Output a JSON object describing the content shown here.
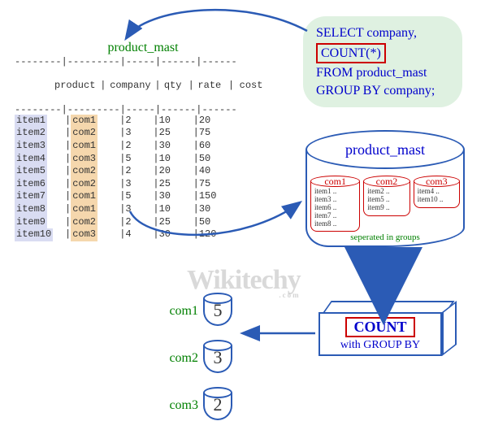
{
  "table": {
    "title": "product_mast",
    "headers": {
      "product": "product",
      "company": "company",
      "qty": "qty",
      "rate": "rate",
      "cost": "cost"
    },
    "dash_row": "--------|---------|-----|------|------",
    "rows": [
      {
        "product": "item1",
        "company": "com1",
        "qty": "2",
        "rate": "10",
        "cost": "20"
      },
      {
        "product": "item2",
        "company": "com2",
        "qty": "3",
        "rate": "25",
        "cost": "75"
      },
      {
        "product": "item3",
        "company": "com1",
        "qty": "2",
        "rate": "30",
        "cost": "60"
      },
      {
        "product": "item4",
        "company": "com3",
        "qty": "5",
        "rate": "10",
        "cost": "50"
      },
      {
        "product": "item5",
        "company": "com2",
        "qty": "2",
        "rate": "20",
        "cost": "40"
      },
      {
        "product": "item6",
        "company": "com2",
        "qty": "3",
        "rate": "25",
        "cost": "75"
      },
      {
        "product": "item7",
        "company": "com1",
        "qty": "5",
        "rate": "30",
        "cost": "150"
      },
      {
        "product": "item8",
        "company": "com1",
        "qty": "3",
        "rate": "10",
        "cost": "30"
      },
      {
        "product": "item9",
        "company": "com2",
        "qty": "2",
        "rate": "25",
        "cost": "50"
      },
      {
        "product": "item10",
        "company": "com3",
        "qty": "4",
        "rate": "30",
        "cost": "120"
      }
    ]
  },
  "sql": {
    "line1": "SELECT company,",
    "line2": "COUNT(*)",
    "line3": "FROM product_mast",
    "line4": "GROUP BY company;"
  },
  "db": {
    "title": "product_mast",
    "separated_text": "seperated in groups",
    "groups": [
      {
        "name": "com1",
        "items": [
          "item1 ..",
          "item3 ..",
          "item6 ..",
          "item7 ..",
          "item8 .."
        ]
      },
      {
        "name": "com2",
        "items": [
          "item2 ..",
          "item5 ..",
          "item9 .."
        ]
      },
      {
        "name": "com3",
        "items": [
          "item4 ..",
          "item10 .."
        ]
      }
    ]
  },
  "countbox": {
    "label": "COUNT",
    "sub": "with GROUP BY"
  },
  "results": [
    {
      "label": "com1",
      "value": "5"
    },
    {
      "label": "com2",
      "value": "3"
    },
    {
      "label": "com3",
      "value": "2"
    }
  ],
  "watermark": {
    "text": "Wikitechy",
    "sub": ".com"
  }
}
